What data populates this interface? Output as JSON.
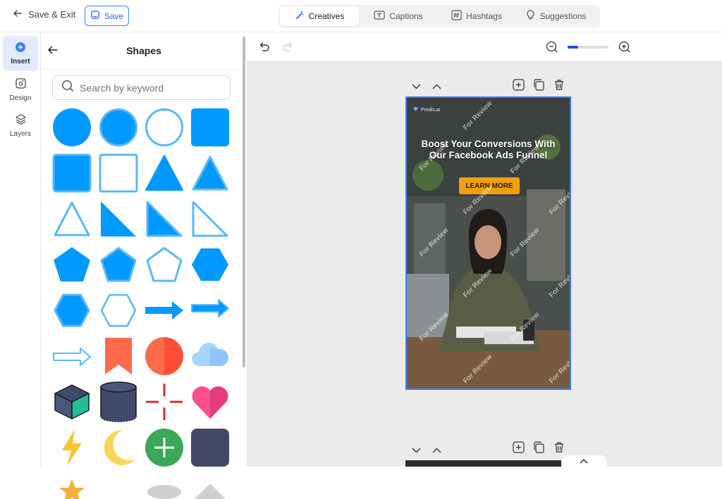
{
  "topbar": {
    "save_exit_label": "Save & Exit",
    "save_label": "Save",
    "tabs": [
      {
        "label": "Creatives",
        "icon": "magic-wand-icon",
        "active": true
      },
      {
        "label": "Captions",
        "icon": "caption-icon",
        "active": false
      },
      {
        "label": "Hashtags",
        "icon": "hashtag-icon",
        "active": false
      },
      {
        "label": "Suggestions",
        "icon": "lightbulb-icon",
        "active": false
      }
    ]
  },
  "rail": {
    "items": [
      {
        "label": "Insert",
        "icon": "plus-circle-icon",
        "active": true
      },
      {
        "label": "Design",
        "icon": "palette-icon",
        "active": false
      },
      {
        "label": "Layers",
        "icon": "layers-icon",
        "active": false
      }
    ]
  },
  "panel": {
    "title": "Shapes",
    "search_placeholder": "Search by keyword"
  },
  "canvas": {
    "ad": {
      "brand": "Predis.ai",
      "headline_line1": "Boost Your Conversions With",
      "headline_line2": "Our Facebook Ads Funnel",
      "cta": "LEARN MORE",
      "watermark": "For Review"
    }
  },
  "colors": {
    "accent": "#0099ff",
    "outline_blue": "#5ab8f5",
    "cta_orange": "#f59e0b",
    "selection_border": "#3b82f6"
  }
}
